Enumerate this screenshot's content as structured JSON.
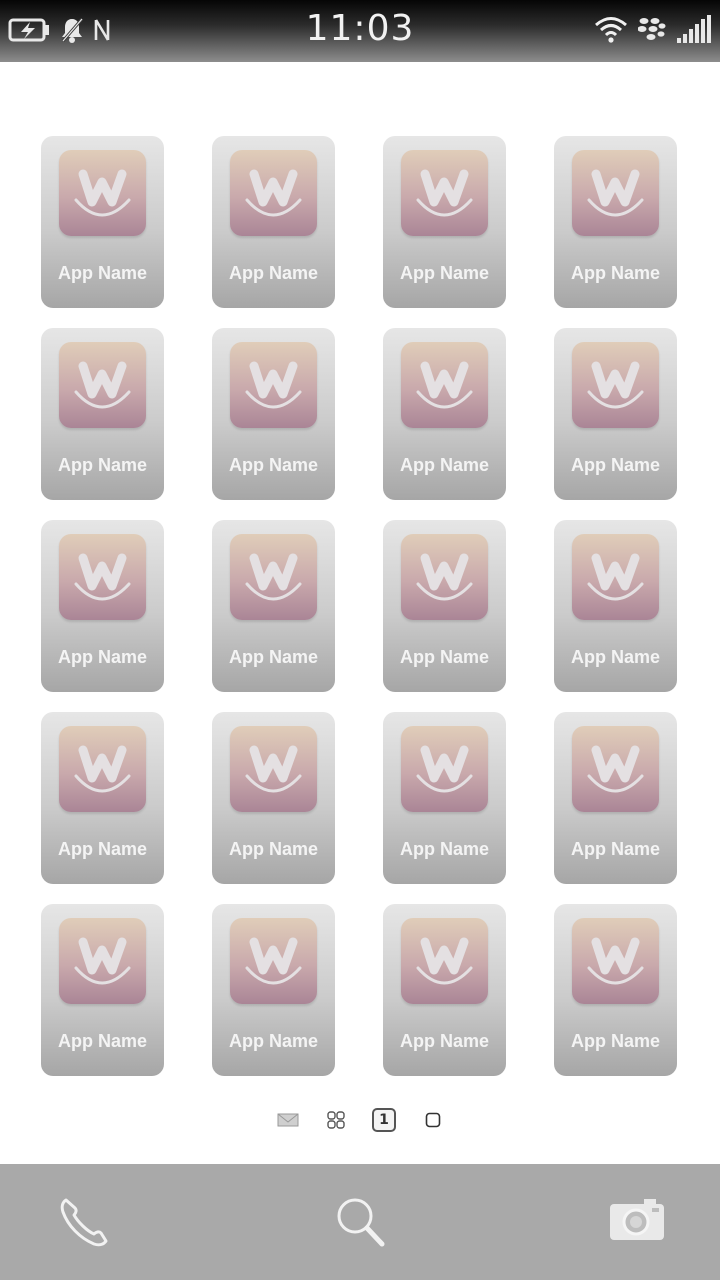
{
  "status_bar": {
    "time": "11:03",
    "left_icons": [
      "battery-charging-icon",
      "notifications-muted-icon",
      "nfc-icon"
    ],
    "right_icons": [
      "wifi-icon",
      "blackberry-logo-icon",
      "signal-bars-icon"
    ]
  },
  "apps": [
    {
      "label": "App Name"
    },
    {
      "label": "App Name"
    },
    {
      "label": "App Name"
    },
    {
      "label": "App Name"
    },
    {
      "label": "App Name"
    },
    {
      "label": "App Name"
    },
    {
      "label": "App Name"
    },
    {
      "label": "App Name"
    },
    {
      "label": "App Name"
    },
    {
      "label": "App Name"
    },
    {
      "label": "App Name"
    },
    {
      "label": "App Name"
    },
    {
      "label": "App Name"
    },
    {
      "label": "App Name"
    },
    {
      "label": "App Name"
    },
    {
      "label": "App Name"
    },
    {
      "label": "App Name"
    },
    {
      "label": "App Name"
    },
    {
      "label": "App Name"
    },
    {
      "label": "App Name"
    }
  ],
  "app_icon_symbol": "w-smile-app-icon",
  "pager": {
    "items": [
      "hub-mail-icon",
      "active-frames-icon",
      "page-1",
      "page-2-icon"
    ],
    "current_page": "1"
  },
  "dock": {
    "items": [
      "phone-icon",
      "search-icon",
      "camera-icon"
    ]
  },
  "colors": {
    "tile_top": "#e6e6e6",
    "tile_bottom": "#a6a6a6",
    "icon_top": "#e0cdb9",
    "icon_bottom": "#aa8596",
    "dock": "#a9a9a9"
  }
}
